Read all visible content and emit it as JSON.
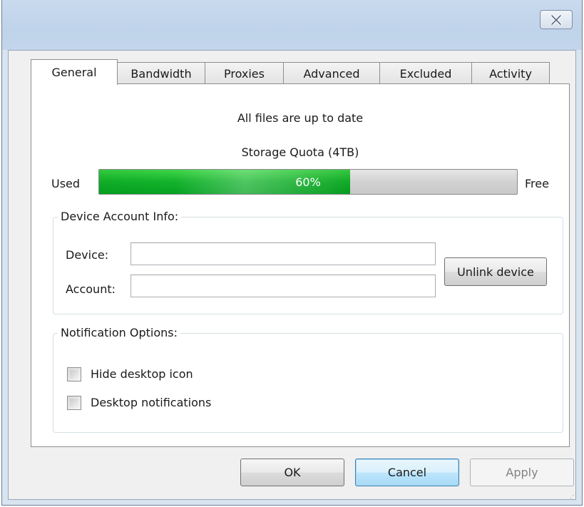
{
  "window": {
    "close_icon": "close-icon"
  },
  "tabs": [
    {
      "label": "General",
      "active": true
    },
    {
      "label": "Bandwidth",
      "active": false
    },
    {
      "label": "Proxies",
      "active": false
    },
    {
      "label": "Advanced",
      "active": false
    },
    {
      "label": "Excluded",
      "active": false
    },
    {
      "label": "Activity",
      "active": false
    }
  ],
  "general": {
    "status": "All files are up to date",
    "quota_title": "Storage Quota (4TB)",
    "used_label": "Used",
    "free_label": "Free",
    "quota_percent_text": "60%",
    "quota_fraction": 0.6
  },
  "device_account": {
    "legend": "Device Account Info:",
    "device_label": "Device:",
    "device_value": "",
    "account_label": "Account:",
    "account_value": "",
    "unlink_button": "Unlink device"
  },
  "notifications": {
    "legend": "Notification Options:",
    "options": [
      {
        "label": "Hide desktop icon",
        "checked": false
      },
      {
        "label": "Desktop notifications",
        "checked": false
      }
    ]
  },
  "buttons": {
    "ok": "OK",
    "cancel": "Cancel",
    "apply": "Apply"
  },
  "colors": {
    "progress_fill": "#14b22c",
    "titlebar": "#c9daee",
    "dialog_bg": "#f0f0f0"
  }
}
